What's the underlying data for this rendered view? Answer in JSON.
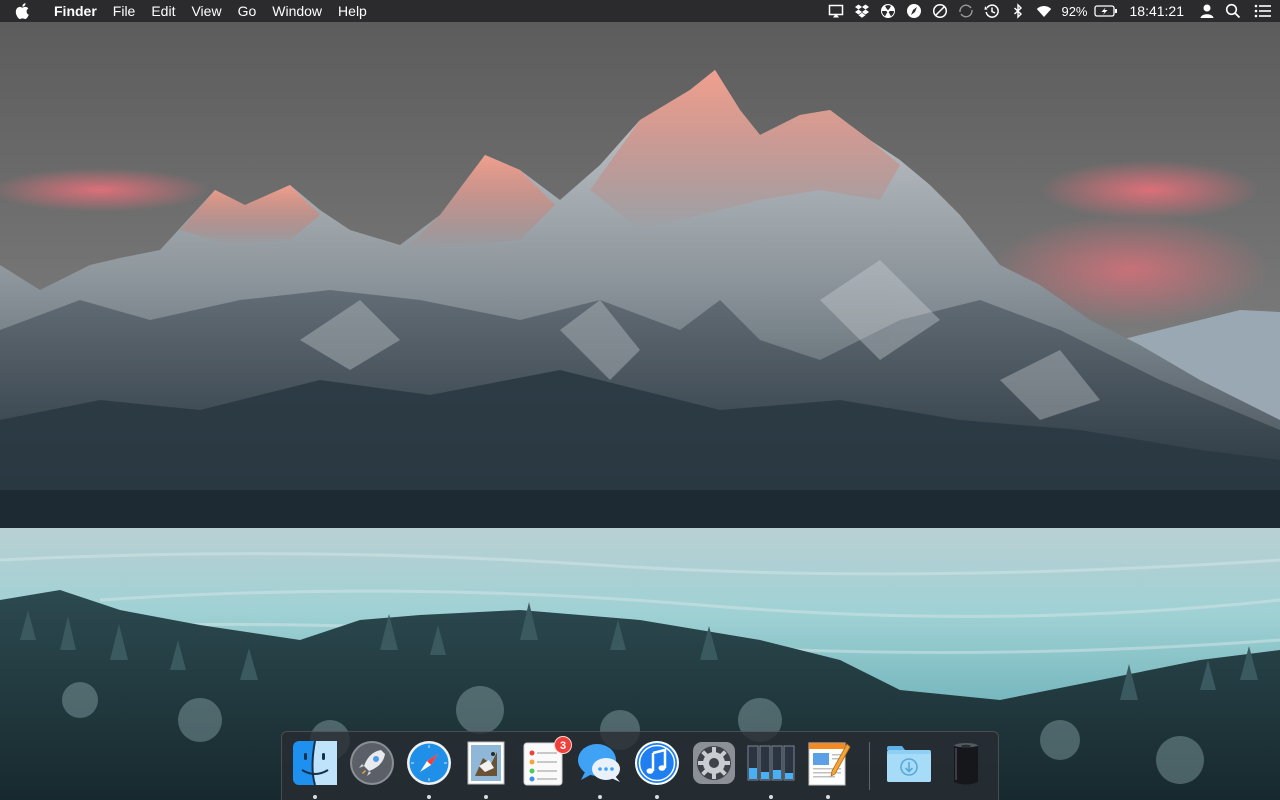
{
  "menubar": {
    "app_name": "Finder",
    "menus": [
      "File",
      "Edit",
      "View",
      "Go",
      "Window",
      "Help"
    ],
    "status": {
      "icons": [
        "airplay-icon",
        "dropbox-icon",
        "radiation-icon",
        "compass-icon",
        "do-not-disturb-icon",
        "sync-icon",
        "time-machine-icon",
        "bluetooth-icon",
        "wifi-icon"
      ],
      "battery_percent": "92%",
      "clock": "18:41:21",
      "trailing_icons": [
        "user-icon",
        "spotlight-search-icon",
        "notification-center-icon"
      ]
    }
  },
  "dock": {
    "apps": [
      {
        "name": "finder",
        "running": true
      },
      {
        "name": "launchpad",
        "running": false
      },
      {
        "name": "safari",
        "running": true
      },
      {
        "name": "mail",
        "running": true
      },
      {
        "name": "reminders",
        "running": false,
        "badge": "3"
      },
      {
        "name": "messages",
        "running": true
      },
      {
        "name": "itunes",
        "running": true
      },
      {
        "name": "system-preferences",
        "running": false
      },
      {
        "name": "activity-monitor",
        "running": true
      },
      {
        "name": "pages",
        "running": true
      }
    ],
    "stacks": [
      {
        "name": "downloads-folder"
      },
      {
        "name": "trash"
      }
    ]
  },
  "colors": {
    "menubar_bg": "#2b2b2d",
    "dock_bg": "#282c32",
    "badge": "#f0403a"
  }
}
